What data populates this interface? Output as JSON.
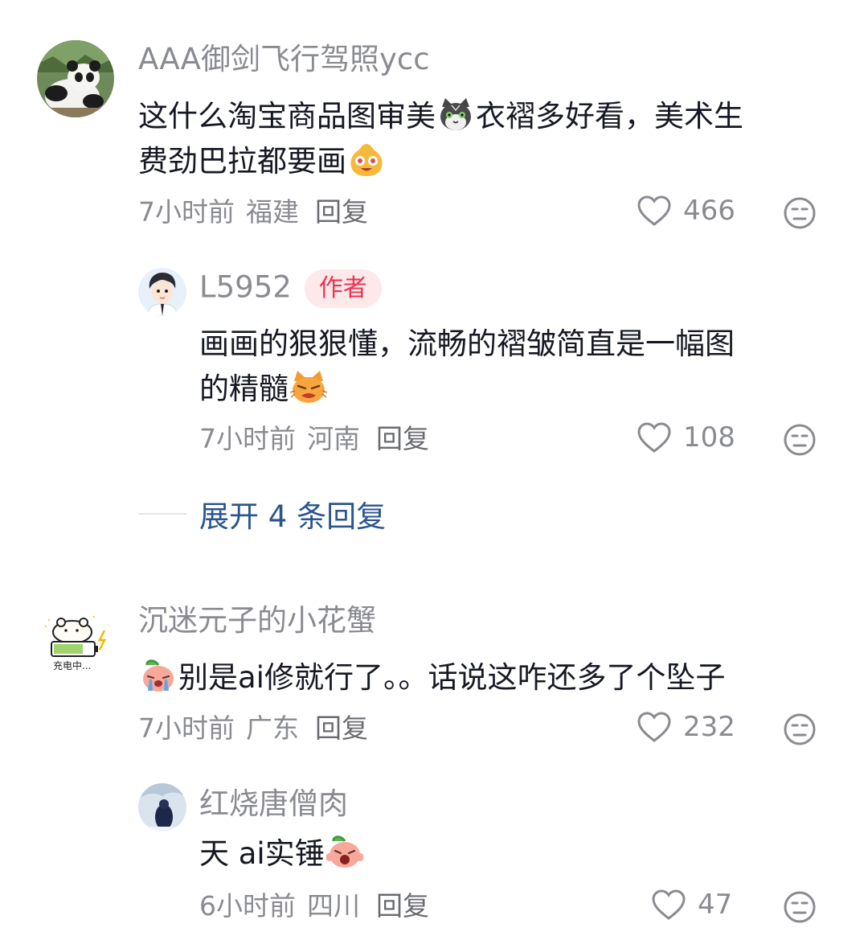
{
  "comments": [
    {
      "username": "AAA御剑飞行驾照ycc",
      "text_1": "这什么淘宝商品图审美",
      "text_2": "衣褶多好看，美术生",
      "text_3": "费劲巴拉都要画",
      "time": "7小时前",
      "location": "福建",
      "reply_label": "回复",
      "likes": "466"
    },
    {
      "username": "沉迷元子的小花蟹",
      "text_1": "别是ai修就行了。。话说这咋还多了个坠子",
      "time": "7小时前",
      "location": "广东",
      "reply_label": "回复",
      "likes": "232"
    }
  ],
  "replies": [
    {
      "username": "L5952",
      "badge": "作者",
      "text_1": "画画的狠狠懂，流畅的褶皱简直是一幅图",
      "text_2": "的精髓",
      "time": "7小时前",
      "location": "河南",
      "reply_label": "回复",
      "likes": "108"
    },
    {
      "username": "红烧唐僧肉",
      "text_1": "天 ai实锤",
      "time": "6小时前",
      "location": "四川",
      "reply_label": "回复",
      "likes": "47"
    }
  ],
  "expand": {
    "label": "展开 4 条回复"
  },
  "icons": {
    "like": "heart-outline-icon",
    "dislike": "unamused-face-icon"
  },
  "colors": {
    "text": "#161823",
    "muted": "#8a8b91",
    "author_badge_bg": "#fde8ea",
    "author_badge_text": "#f0314d",
    "expand_link": "#2a5590"
  }
}
